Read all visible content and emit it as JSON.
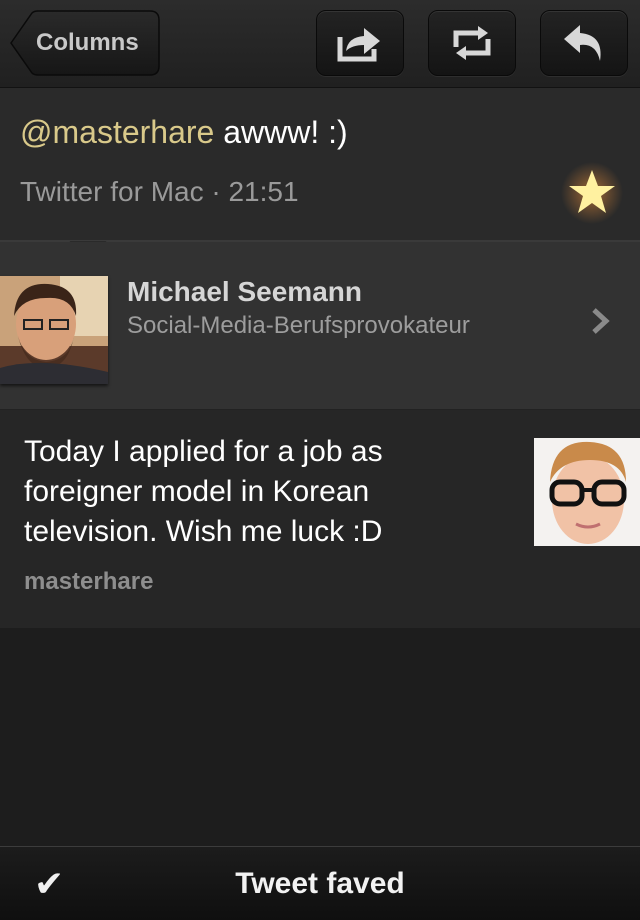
{
  "toolbar": {
    "back_label": "Columns",
    "actions": [
      {
        "icon": "share-icon"
      },
      {
        "icon": "retweet-icon"
      },
      {
        "icon": "reply-icon"
      }
    ]
  },
  "tweet": {
    "mention": "@masterhare",
    "text": " awww! :)",
    "meta": "Twitter for Mac · 21:51",
    "favorited": true,
    "star_color": "#fff1a0"
  },
  "author": {
    "name": "Michael Seemann",
    "bio": "Social-Media-Berufsprovokateur"
  },
  "original": {
    "lines": [
      "Today I applied for a job as",
      "foreigner model in Korean",
      "television. Wish me luck :D"
    ],
    "user": "masterhare"
  },
  "status": {
    "icon": "checkmark-icon",
    "check_glyph": "✔",
    "text": "Tweet faved"
  },
  "colors": {
    "mention": "#d9c98a",
    "background": "#1d1d1d"
  }
}
